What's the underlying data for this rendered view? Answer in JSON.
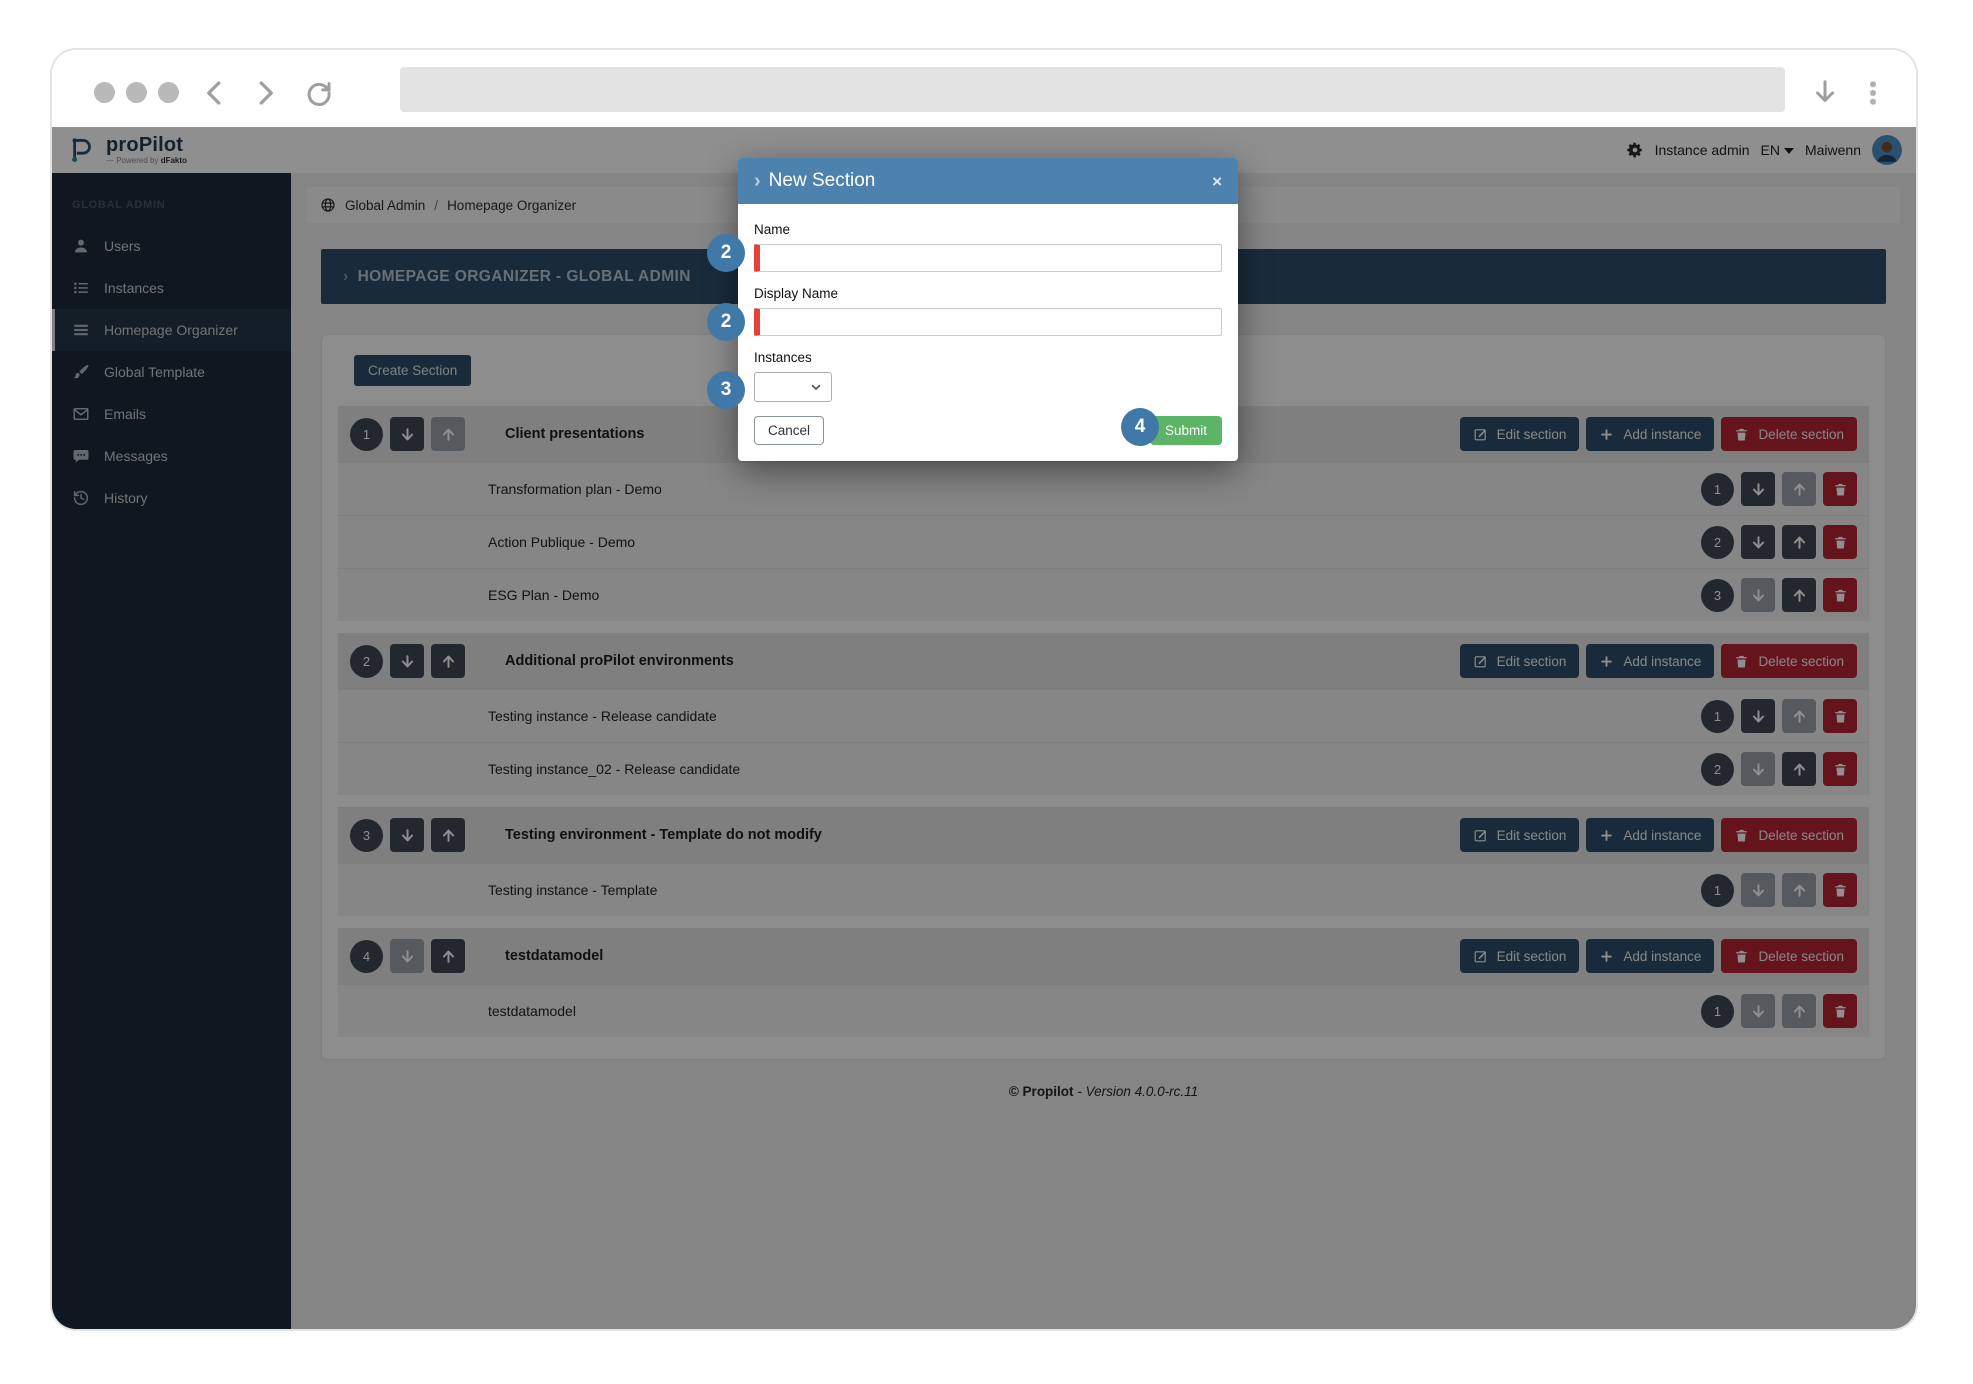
{
  "browser": {
    "address_value": "",
    "icons": {
      "back": "back-chevron",
      "forward": "forward-chevron",
      "refresh": "refresh-arrow",
      "download": "download-arrow",
      "menu": "kebab-menu"
    }
  },
  "header": {
    "logo_name": "proPilot",
    "logo_sub_prefix": "— Powered by ",
    "logo_sub_brand": "dFakto",
    "instance_admin_label": "Instance admin",
    "language": "EN",
    "user_name": "Maiwenn"
  },
  "sidebar": {
    "group_label": "GLOBAL ADMIN",
    "items": [
      {
        "label": "Users",
        "icon": "user-icon",
        "active": false
      },
      {
        "label": "Instances",
        "icon": "list-icon",
        "active": false
      },
      {
        "label": "Homepage Organizer",
        "icon": "menu-bars-icon",
        "active": true
      },
      {
        "label": "Global Template",
        "icon": "brush-icon",
        "active": false
      },
      {
        "label": "Emails",
        "icon": "envelope-icon",
        "active": false
      },
      {
        "label": "Messages",
        "icon": "chat-icon",
        "active": false
      },
      {
        "label": "History",
        "icon": "history-icon",
        "active": false
      }
    ]
  },
  "breadcrumb": {
    "root": "Global Admin",
    "separator": "/",
    "current": "Homepage Organizer"
  },
  "page": {
    "title_chevron": "›",
    "title": "HOMEPAGE ORGANIZER - GLOBAL ADMIN",
    "create_section_label": "Create Section"
  },
  "section_actions": {
    "edit_label": "Edit section",
    "add_label": "Add instance",
    "delete_label": "Delete section"
  },
  "sections": [
    {
      "order": "1",
      "title": "Client presentations",
      "move_down_enabled": true,
      "move_up_enabled": false,
      "instances": [
        {
          "order": "1",
          "name": "Transformation plan - Demo",
          "move_down_enabled": true,
          "move_up_enabled": false
        },
        {
          "order": "2",
          "name": "Action Publique - Demo",
          "move_down_enabled": true,
          "move_up_enabled": true
        },
        {
          "order": "3",
          "name": "ESG Plan - Demo",
          "move_down_enabled": false,
          "move_up_enabled": true
        }
      ]
    },
    {
      "order": "2",
      "title": "Additional proPilot environments",
      "move_down_enabled": true,
      "move_up_enabled": true,
      "instances": [
        {
          "order": "1",
          "name": "Testing instance - Release candidate",
          "move_down_enabled": true,
          "move_up_enabled": false
        },
        {
          "order": "2",
          "name": "Testing instance_02 - Release candidate",
          "move_down_enabled": false,
          "move_up_enabled": true
        }
      ]
    },
    {
      "order": "3",
      "title": "Testing environment - Template do not modify",
      "move_down_enabled": true,
      "move_up_enabled": true,
      "instances": [
        {
          "order": "1",
          "name": "Testing instance - Template",
          "move_down_enabled": false,
          "move_up_enabled": false
        }
      ]
    },
    {
      "order": "4",
      "title": "testdatamodel",
      "move_down_enabled": false,
      "move_up_enabled": true,
      "instances": [
        {
          "order": "1",
          "name": "testdatamodel",
          "move_down_enabled": false,
          "move_up_enabled": false
        }
      ]
    }
  ],
  "footer": {
    "copyright": "© Propilot",
    "version": "- Version 4.0.0-rc.11"
  },
  "modal": {
    "title_chevron": "›",
    "title": "New Section",
    "close_glyph": "×",
    "name_label": "Name",
    "name_value": "",
    "display_name_label": "Display Name",
    "display_name_value": "",
    "instances_label": "Instances",
    "instances_value": "",
    "cancel_label": "Cancel",
    "submit_label": "Submit"
  },
  "annotations": {
    "steps": [
      "2",
      "2",
      "3",
      "4"
    ]
  },
  "colors": {
    "modal_header_blue": "#4d82ae",
    "dark_slate_blue": "#2e4d68",
    "sidebar_navy": "#1c2b39",
    "danger_red": "#b42534",
    "error_border_red": "#e8403a",
    "success_green": "#5cb567",
    "annotation_blue": "#4078a8"
  }
}
